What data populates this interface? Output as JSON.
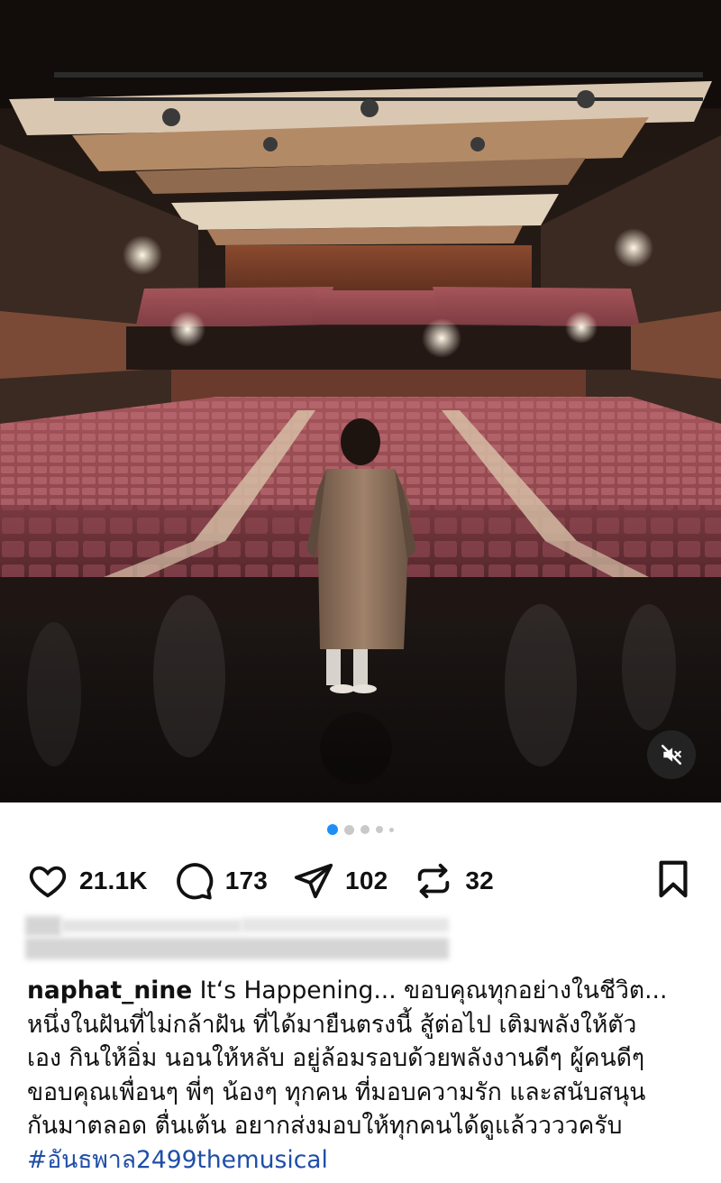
{
  "post": {
    "username": "naphat_nine",
    "caption_lines": [
      "It‘s Happening... ขอบคุณทุกอย่างในชีวิต...",
      "หนึ่งในฝันที่ไม่กล้าฝัน ที่ได้มายืนตรงนี้ สู้ต่อไป เติมพลังให้ตัว",
      "เอง กินให้อิ่ม นอนให้หลับ อยู่ล้อมรอบด้วยพลังงานดีๆ ผู้คนดีๆ",
      "ขอบคุณเพื่อนๆ พี่ๆ น้องๆ ทุกคน ที่มอบความรัก และสนับสนุน",
      "กันมาตลอด ตื่นเต้น อยากส่งมอบให้ทุกคนได้ดูแล้ววววครับ"
    ],
    "hashtag": "#อันธพาล2499themusical"
  },
  "stats": {
    "likes": "21.1K",
    "comments": "173",
    "shares": "102",
    "reposts": "32"
  },
  "carousel": {
    "total_dots": 5,
    "active_index": 0,
    "active_color": "#1e90f5"
  },
  "icons": {
    "like": "heart-outline-icon",
    "comment": "speech-bubble-icon",
    "share": "paper-plane-icon",
    "repost": "repost-arrows-icon",
    "save": "bookmark-icon",
    "mute": "speaker-muted-icon"
  }
}
